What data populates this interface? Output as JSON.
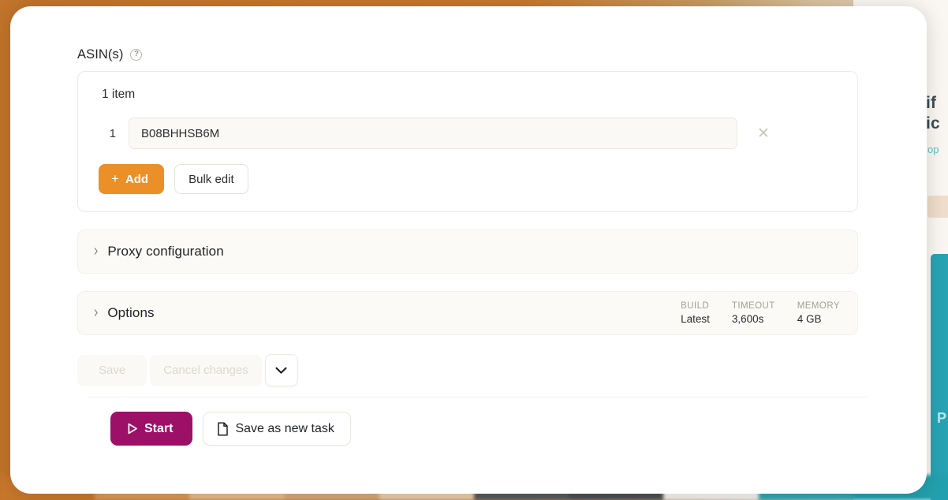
{
  "backdrop": {
    "edge_color": "#c8782c",
    "right_panel_bg": "#faf7f2",
    "right_text_fragment": "if\nic",
    "right_sub_fragment": "op",
    "right_teal_color": "#27a3b4",
    "right_teal_glyph": "P",
    "bottom_strip_colors": [
      "#c8782c",
      "#d99a5a",
      "#e8bb8c",
      "#d8a97b",
      "#eacfae",
      "#575b5c",
      "#4b5054",
      "#f4f4f2",
      "#2fa6b3",
      "#23a0ae"
    ]
  },
  "form": {
    "field_label": "ASIN(s)",
    "help_icon": "question-circle-icon",
    "item_count": "1 item",
    "items": [
      {
        "index": "1",
        "value": "B08BHHSB6M",
        "placeholder": "",
        "remove_icon": "close-icon"
      }
    ],
    "add_label": "Add",
    "add_icon": "plus-icon",
    "add_color": "#ea9026",
    "bulk_edit_label": "Bulk edit"
  },
  "sections": [
    {
      "name": "proxy-configuration",
      "title": "Proxy configuration",
      "chevron": "chevron-right-icon",
      "expanded": false,
      "meta": []
    },
    {
      "name": "options",
      "title": "Options",
      "chevron": "chevron-right-icon",
      "expanded": false,
      "meta": [
        {
          "key": "BUILD",
          "value": "Latest"
        },
        {
          "key": "TIMEOUT",
          "value": "3,600s"
        },
        {
          "key": "MEMORY",
          "value": "4 GB"
        }
      ]
    }
  ],
  "savebar": {
    "save_label": "Save",
    "save_disabled": true,
    "cancel_label": "Cancel changes",
    "cancel_disabled": true,
    "caret_icon": "chevron-down-icon"
  },
  "actions": {
    "start_label": "Start",
    "start_icon": "play-icon",
    "start_color": "#9c1068",
    "save_as_new_label": "Save as new task",
    "save_as_new_icon": "file-icon"
  }
}
